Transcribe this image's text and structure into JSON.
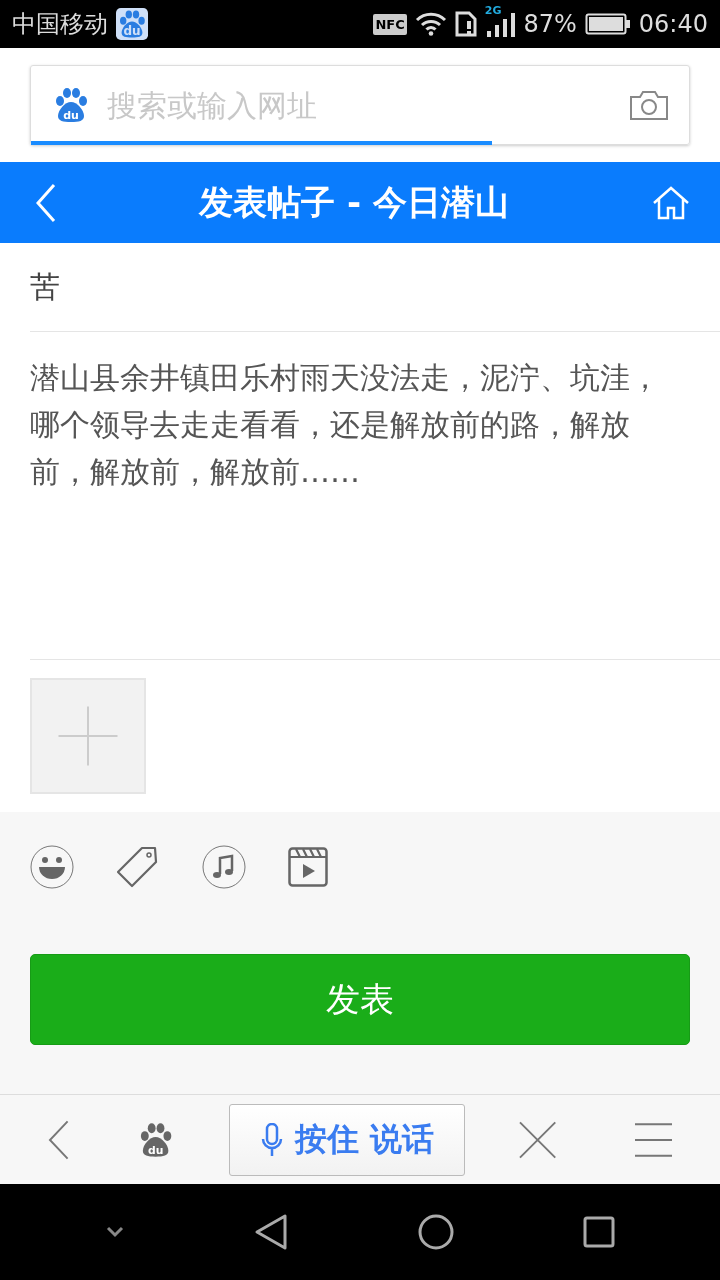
{
  "status_bar": {
    "carrier": "中国移动",
    "app_logo_text": "du",
    "nfc": "NFC",
    "network": "2G",
    "battery": "87%",
    "time": "06:40"
  },
  "address_bar": {
    "logo_text": "du",
    "placeholder": "搜索或输入网址",
    "load_progress": {
      "level": 0.7
    }
  },
  "header": {
    "title": "发表帖子 - 今日潜山"
  },
  "post": {
    "title": "苦",
    "body": "潜山县余井镇田乐村雨天没法走，泥泞、坑洼，哪个领导去走走看看，还是解放前的路，解放前，解放前，解放前……"
  },
  "submit_button": "发表",
  "toolbar": {
    "logo_text": "du",
    "voice_button": "按住 说话"
  }
}
